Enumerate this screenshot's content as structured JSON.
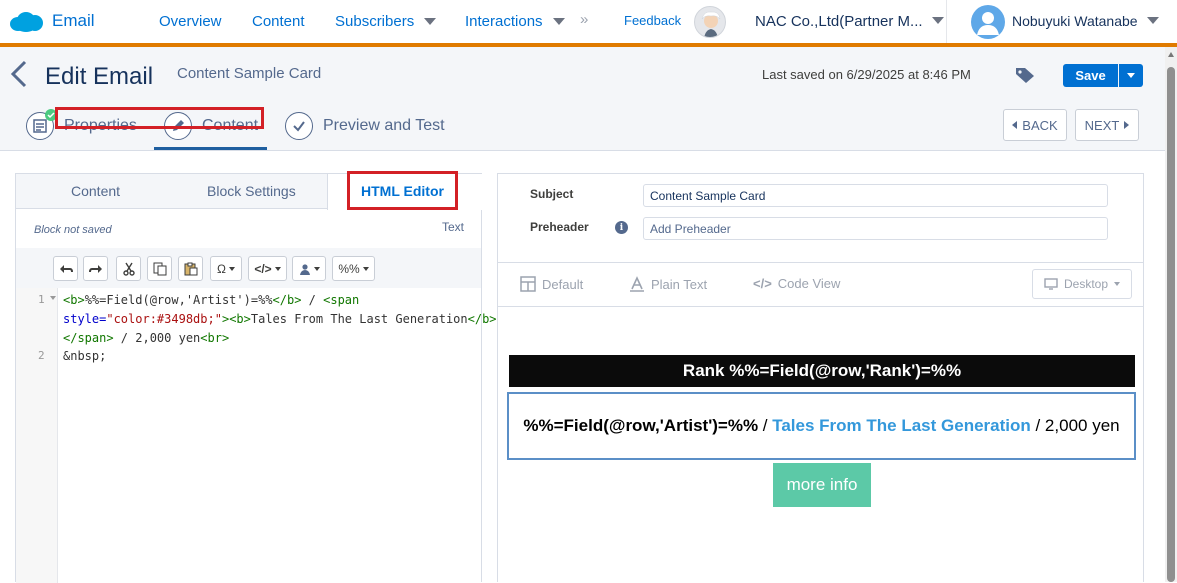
{
  "topbar": {
    "app_name": "Email",
    "nav": [
      "Overview",
      "Content",
      "Subscribers",
      "Interactions"
    ],
    "more_symbol": "»",
    "feedback": "Feedback",
    "org": "NAC Co.,Ltd(Partner M...",
    "user": "Nobuyuki Watanabe",
    "accent_color": "#e07b00"
  },
  "header": {
    "title": "Edit Email",
    "email_name": "Content Sample Card",
    "last_saved": "Last saved on 6/29/2025 at 8:46 PM",
    "save_label": "Save"
  },
  "steps": {
    "items": [
      {
        "label": "Properties",
        "icon": "properties-complete-icon"
      },
      {
        "label": "Content",
        "icon": "pencil-icon"
      },
      {
        "label": "Preview and Test",
        "icon": "check-icon"
      }
    ],
    "active": "Content",
    "back": "BACK",
    "next": "NEXT"
  },
  "editor": {
    "tabs": [
      "Content",
      "Block Settings",
      "HTML Editor"
    ],
    "active_tab": "HTML Editor",
    "block_status": "Block not saved",
    "mode_label": "Text",
    "toolbar": [
      "undo-icon",
      "redo-icon",
      "cut-icon",
      "copy-icon",
      "paste-icon",
      "Ω",
      "</>",
      "person-icon",
      "%%"
    ],
    "line_numbers": [
      "1",
      "2"
    ],
    "code": {
      "l1a_tag_open": "<b>",
      "l1a_text": "%%=Field(@row,'Artist')=%%",
      "l1a_tag_close": "</b>",
      "l1a_rest": " / ",
      "l1a_span": "<span",
      "l1b_attr": "style=",
      "l1b_val": "\"color:#3498db;\"",
      "l1b_gt": ">",
      "l1b_b": "<b>",
      "l1b_text": "Tales From The Last Generation",
      "l1b_bclose": "</b>",
      "l1c_span_close": "</span>",
      "l1c_text": " / 2,000 yen",
      "l1c_br": "<br>",
      "l2": "&nbsp;"
    }
  },
  "preview": {
    "subject_label": "Subject",
    "subject_value": "Content Sample Card",
    "preheader_label": "Preheader",
    "preheader_placeholder": "Add Preheader",
    "views": [
      "Default",
      "Plain Text",
      "Code View"
    ],
    "device": "Desktop",
    "rank_text": "Rank %%=Field(@row,'Rank')=%%",
    "artist_text": "%%=Field(@row,'Artist')=%%",
    "sep": " / ",
    "title_text": "Tales From The Last Generation",
    "price_text": " / 2,000 yen",
    "more_info": "more info",
    "title_color": "#3498db",
    "button_color": "#5cc9a7"
  }
}
